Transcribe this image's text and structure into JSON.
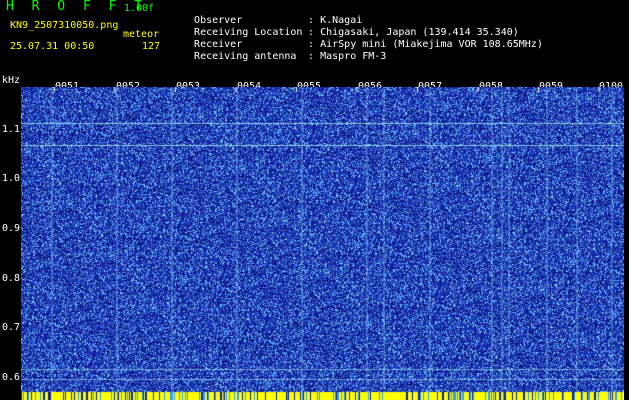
{
  "header": {
    "brand": "H R O F F T",
    "version": "1.00f",
    "filename": "KN9_2507310050.png",
    "mode": "meteor",
    "timestamp": "25.07.31 00:50",
    "count": "127"
  },
  "info": [
    {
      "label": "Observer",
      "value": ": K.Nagai"
    },
    {
      "label": "Receiving Location",
      "value": ": Chigasaki, Japan (139.414 35.340)"
    },
    {
      "label": "Receiver",
      "value": ": AirSpy mini (Miakejima VOR 108.65MHz)"
    },
    {
      "label": "Receiving antenna",
      "value": ": Maspro FM-3"
    }
  ],
  "y_axis": {
    "unit": "kHz",
    "ticks": [
      "1.1",
      "1.0",
      "0.9",
      "0.8",
      "0.7",
      "0.6"
    ]
  },
  "x_axis": {
    "ticks": [
      "0051",
      "0052",
      "0053",
      "0054",
      "0055",
      "0056",
      "0057",
      "0058",
      "0059",
      "0100"
    ]
  },
  "colors": {
    "background": "#000000",
    "spectrum_base": "#1a2bb0",
    "noise": "#8fd8ff",
    "signal_line": "#b8ffff",
    "bottom_bar": "#ffff00"
  }
}
